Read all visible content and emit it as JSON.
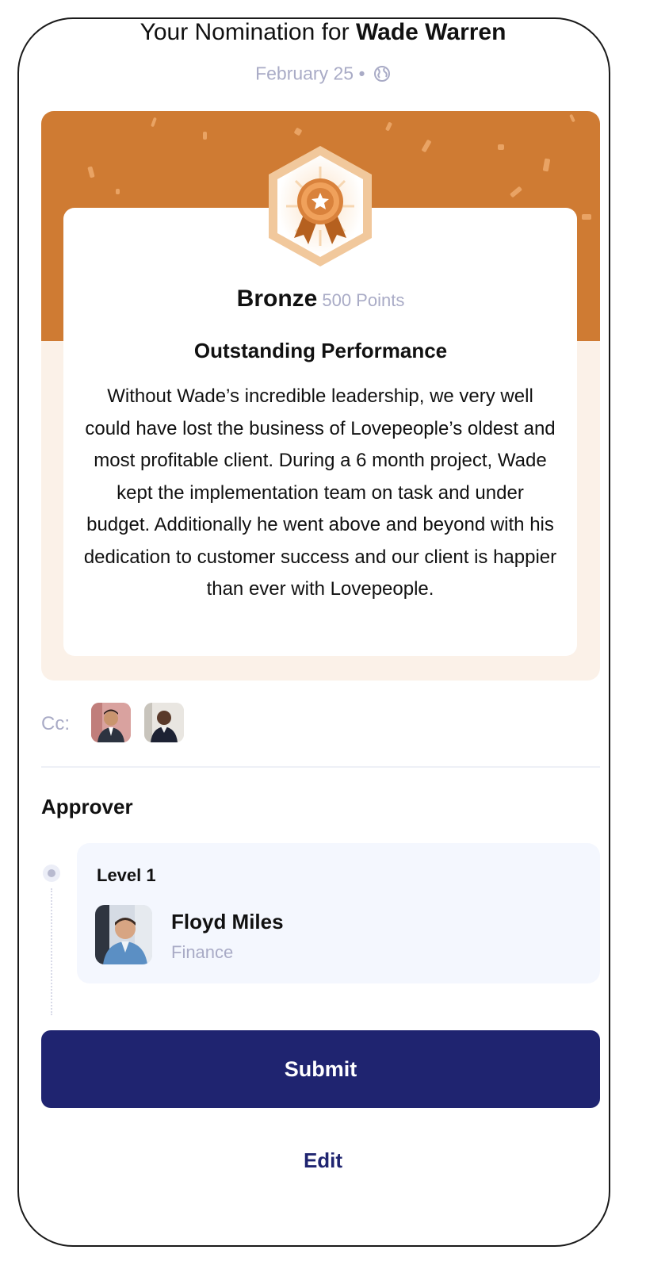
{
  "header": {
    "title_prefix": "Your Nomination for",
    "nominee": "Wade Warren",
    "date": "February 25",
    "separator": "•",
    "visibility_icon": "globe-icon"
  },
  "award": {
    "badge_icon": "ribbon-medal-icon",
    "level": "Bronze",
    "points": "500 Points",
    "heading": "Outstanding Performance",
    "message": "Without Wade’s incredible leadership, we very well could have lost the business of Lovepeople’s oldest and most profitable client. During a 6 month project, Wade kept the implementation team on task and under budget. Additionally he went above and beyond with his dedication to customer success and our client is happier than ever with Lovepeople.",
    "colors": {
      "band": "#cf7b33",
      "card_bg": "#fbf1e8"
    }
  },
  "cc": {
    "label": "Cc:"
  },
  "approver": {
    "section_title": "Approver",
    "level_label": "Level 1",
    "name": "Floyd Miles",
    "department": "Finance"
  },
  "actions": {
    "submit_label": "Submit",
    "edit_label": "Edit",
    "primary_color": "#1f2470"
  }
}
